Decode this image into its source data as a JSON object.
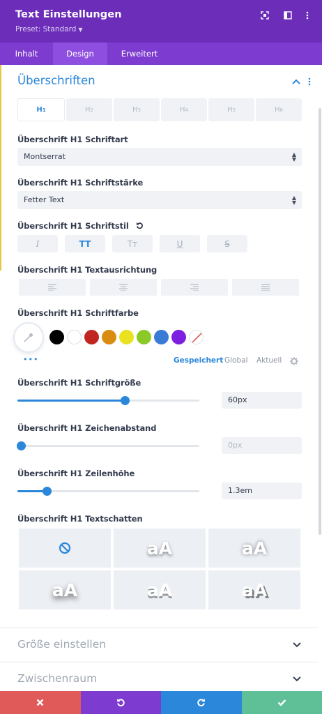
{
  "header": {
    "title": "Text Einstellungen",
    "preset": "Preset: Standard",
    "bg": "#6c2eb9"
  },
  "tabs": [
    {
      "label": "Inhalt",
      "active": false
    },
    {
      "label": "Design",
      "active": true
    },
    {
      "label": "Erweitert",
      "active": false
    }
  ],
  "section": {
    "title": "Überschriften",
    "expanded": true
  },
  "heading_tabs": [
    {
      "main": "H",
      "sub": "1",
      "active": true
    },
    {
      "main": "H",
      "sub": "2",
      "active": false
    },
    {
      "main": "H",
      "sub": "3",
      "active": false
    },
    {
      "main": "H",
      "sub": "4",
      "active": false
    },
    {
      "main": "H",
      "sub": "5",
      "active": false
    },
    {
      "main": "H",
      "sub": "6",
      "active": false
    }
  ],
  "font": {
    "label": "Überschrift H1 Schriftart",
    "value": "Montserrat"
  },
  "weight": {
    "label": "Überschrift H1 Schriftstärke",
    "value": "Fetter Text"
  },
  "style": {
    "label": "Überschrift H1 Schriftstil",
    "buttons": [
      {
        "name": "italic",
        "glyph": "I",
        "active": false
      },
      {
        "name": "uppercase",
        "glyph": "TT",
        "active": true
      },
      {
        "name": "capitalize",
        "glyph": "Tт",
        "active": false
      },
      {
        "name": "underline",
        "glyph": "U",
        "active": false
      },
      {
        "name": "strikethrough",
        "glyph": "S",
        "active": false
      }
    ]
  },
  "alignment": {
    "label": "Überschrift H1 Textausrichtung",
    "options": [
      "left",
      "center",
      "right",
      "justify"
    ]
  },
  "color": {
    "label": "Überschrift H1 Schriftfarbe",
    "swatches": [
      "#000000",
      "#ffffff",
      "#c0261f",
      "#d98c12",
      "#e8e221",
      "#8ac926",
      "#3a7bd5",
      "#7d1fe0"
    ],
    "modes": [
      {
        "label": "Gespeichert",
        "active": true
      },
      {
        "label": "Global",
        "active": false
      },
      {
        "label": "Aktuell",
        "active": false
      }
    ]
  },
  "size": {
    "label": "Überschrift H1 Schriftgröße",
    "value": "60px",
    "level": 0.59
  },
  "spacing": {
    "label": "Überschrift H1 Zeichenabstand",
    "value": "0px",
    "level": 0.02
  },
  "lineheight": {
    "label": "Überschrift H1 Zeilenhöhe",
    "value": "1.3em",
    "level": 0.16
  },
  "shadow": {
    "label": "Überschrift H1 Textschatten",
    "sample": "aA"
  },
  "collapsed": [
    "Größe einstellen",
    "Zwischenraum"
  ],
  "footer": {
    "cancel": "#e05a5a",
    "undo": "#7d3bcf",
    "redo": "#2b87da",
    "save": "#5fc097"
  }
}
